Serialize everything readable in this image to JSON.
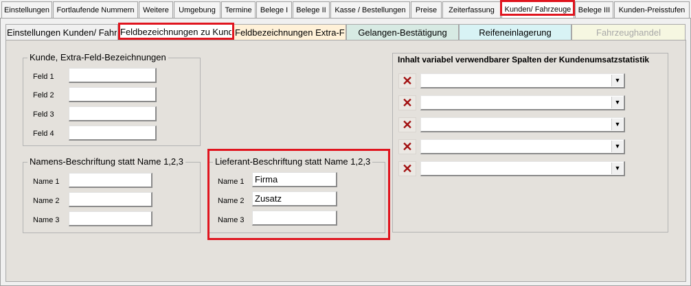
{
  "top_tabs": [
    {
      "label": "Einstellungen"
    },
    {
      "label": "Fortlaufende Nummern"
    },
    {
      "label": "Weitere"
    },
    {
      "label": "Umgebung"
    },
    {
      "label": "Termine"
    },
    {
      "label": "Belege I"
    },
    {
      "label": "Belege II"
    },
    {
      "label": "Kasse / Bestellungen"
    },
    {
      "label": "Preise"
    },
    {
      "label": "Zeiterfassung"
    },
    {
      "label": "Kunden/ Fahrzeuge",
      "active": true
    },
    {
      "label": "Belege III"
    },
    {
      "label": "Kunden-Preisstufen"
    }
  ],
  "sub_tabs": [
    {
      "label": "Einstellungen Kunden/ Fahrz",
      "color": "#f0f0f0"
    },
    {
      "label": "Feldbezeichnungen zu Kunde",
      "color": "#ffffff",
      "active": true
    },
    {
      "label": "Feldbezeichnungen Extra-Fel",
      "color": "#fff1d8"
    },
    {
      "label": "Gelangen-Bestätigung",
      "color": "#d7eae3"
    },
    {
      "label": "Reifeneinlagerung",
      "color": "#d8f3f5"
    },
    {
      "label": "Fahrzeughandel",
      "color": "#f6f7e1",
      "disabled": true
    }
  ],
  "kunde_group": {
    "title": "Kunde, Extra-Feld-Bezeichnungen",
    "fields": [
      {
        "label": "Feld 1",
        "value": ""
      },
      {
        "label": "Feld 2",
        "value": ""
      },
      {
        "label": "Feld 3",
        "value": ""
      },
      {
        "label": "Feld 4",
        "value": ""
      }
    ]
  },
  "namen_group": {
    "title": "Namens-Beschriftung statt Name 1,2,3",
    "fields": [
      {
        "label": "Name 1",
        "value": ""
      },
      {
        "label": "Name 2",
        "value": ""
      },
      {
        "label": "Name 3",
        "value": ""
      }
    ]
  },
  "lieferant_group": {
    "title": "Lieferant-Beschriftung statt Name 1,2,3",
    "fields": [
      {
        "label": "Name 1",
        "value": "Firma"
      },
      {
        "label": "Name 2",
        "value": "Zusatz"
      },
      {
        "label": "Name 3",
        "value": ""
      }
    ]
  },
  "stat_panel": {
    "title": "Inhalt variabel verwendbarer Spalten der Kundenumsatzstatistik",
    "rows": [
      {
        "delete_icon": "x-icon",
        "value": ""
      },
      {
        "delete_icon": "x-icon",
        "value": ""
      },
      {
        "delete_icon": "x-icon",
        "value": ""
      },
      {
        "delete_icon": "x-icon",
        "value": ""
      },
      {
        "delete_icon": "x-icon",
        "value": ""
      }
    ]
  },
  "colors": {
    "highlight": "#e0141e",
    "delete_icon": "#a21010",
    "panel_bg": "#e4e1dc"
  }
}
